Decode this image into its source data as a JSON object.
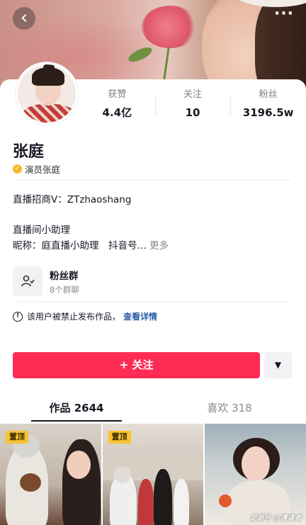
{
  "header": {
    "back_icon": "chevron-left-icon",
    "more_icon": "ellipsis-icon"
  },
  "profile": {
    "name": "张庭",
    "verified_label": "演员张庭",
    "stats": [
      {
        "label": "获赞",
        "value": "4.4亿"
      },
      {
        "label": "关注",
        "value": "10"
      },
      {
        "label": "粉丝",
        "value": "3196.5w"
      }
    ],
    "bio_line1": "直播招商V：ZTzhaoshang",
    "bio_line2": "直播间小助理",
    "bio_line3": "昵称：庭直播小助理　抖音号…",
    "more_label": "更多"
  },
  "fan_group": {
    "title": "粉丝群",
    "subtitle": "8个群聊"
  },
  "ban_notice": {
    "text": "该用户被禁止发布作品，",
    "link": "查看详情"
  },
  "actions": {
    "follow_label": "+ 关注",
    "dropdown_icon": "caret-down-icon"
  },
  "tabs": [
    {
      "label": "作品 2644",
      "active": true
    },
    {
      "label": "喜欢 318",
      "active": false
    }
  ],
  "videos": [
    {
      "pin_label": "置顶"
    },
    {
      "pin_label": "置顶"
    },
    {
      "watermark": "龙湖号 @清读者"
    }
  ],
  "colors": {
    "accent": "#fe2c55",
    "pin": "#f9c230",
    "link": "#2d5ea8"
  }
}
